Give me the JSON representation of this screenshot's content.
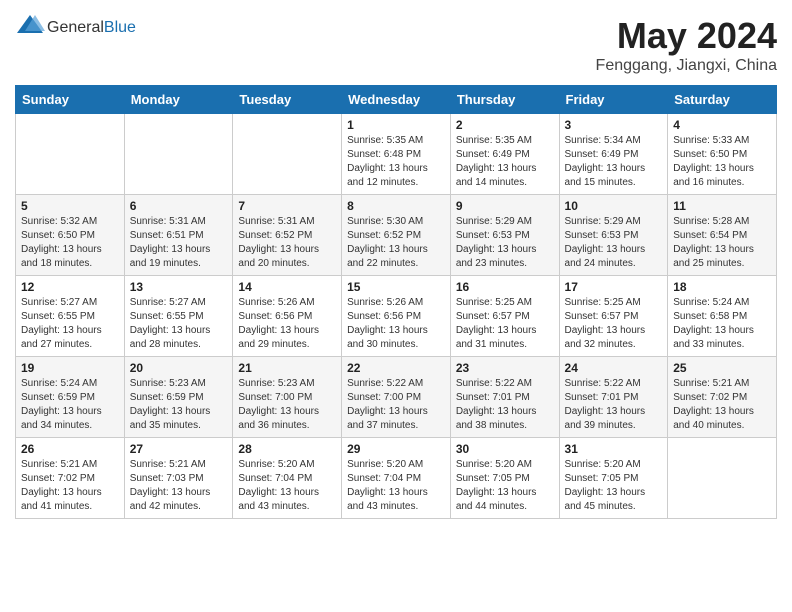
{
  "header": {
    "logo_general": "General",
    "logo_blue": "Blue",
    "title": "May 2024",
    "location": "Fenggang, Jiangxi, China"
  },
  "weekdays": [
    "Sunday",
    "Monday",
    "Tuesday",
    "Wednesday",
    "Thursday",
    "Friday",
    "Saturday"
  ],
  "weeks": [
    [
      {
        "day": "",
        "info": ""
      },
      {
        "day": "",
        "info": ""
      },
      {
        "day": "",
        "info": ""
      },
      {
        "day": "1",
        "info": "Sunrise: 5:35 AM\nSunset: 6:48 PM\nDaylight: 13 hours\nand 12 minutes."
      },
      {
        "day": "2",
        "info": "Sunrise: 5:35 AM\nSunset: 6:49 PM\nDaylight: 13 hours\nand 14 minutes."
      },
      {
        "day": "3",
        "info": "Sunrise: 5:34 AM\nSunset: 6:49 PM\nDaylight: 13 hours\nand 15 minutes."
      },
      {
        "day": "4",
        "info": "Sunrise: 5:33 AM\nSunset: 6:50 PM\nDaylight: 13 hours\nand 16 minutes."
      }
    ],
    [
      {
        "day": "5",
        "info": "Sunrise: 5:32 AM\nSunset: 6:50 PM\nDaylight: 13 hours\nand 18 minutes."
      },
      {
        "day": "6",
        "info": "Sunrise: 5:31 AM\nSunset: 6:51 PM\nDaylight: 13 hours\nand 19 minutes."
      },
      {
        "day": "7",
        "info": "Sunrise: 5:31 AM\nSunset: 6:52 PM\nDaylight: 13 hours\nand 20 minutes."
      },
      {
        "day": "8",
        "info": "Sunrise: 5:30 AM\nSunset: 6:52 PM\nDaylight: 13 hours\nand 22 minutes."
      },
      {
        "day": "9",
        "info": "Sunrise: 5:29 AM\nSunset: 6:53 PM\nDaylight: 13 hours\nand 23 minutes."
      },
      {
        "day": "10",
        "info": "Sunrise: 5:29 AM\nSunset: 6:53 PM\nDaylight: 13 hours\nand 24 minutes."
      },
      {
        "day": "11",
        "info": "Sunrise: 5:28 AM\nSunset: 6:54 PM\nDaylight: 13 hours\nand 25 minutes."
      }
    ],
    [
      {
        "day": "12",
        "info": "Sunrise: 5:27 AM\nSunset: 6:55 PM\nDaylight: 13 hours\nand 27 minutes."
      },
      {
        "day": "13",
        "info": "Sunrise: 5:27 AM\nSunset: 6:55 PM\nDaylight: 13 hours\nand 28 minutes."
      },
      {
        "day": "14",
        "info": "Sunrise: 5:26 AM\nSunset: 6:56 PM\nDaylight: 13 hours\nand 29 minutes."
      },
      {
        "day": "15",
        "info": "Sunrise: 5:26 AM\nSunset: 6:56 PM\nDaylight: 13 hours\nand 30 minutes."
      },
      {
        "day": "16",
        "info": "Sunrise: 5:25 AM\nSunset: 6:57 PM\nDaylight: 13 hours\nand 31 minutes."
      },
      {
        "day": "17",
        "info": "Sunrise: 5:25 AM\nSunset: 6:57 PM\nDaylight: 13 hours\nand 32 minutes."
      },
      {
        "day": "18",
        "info": "Sunrise: 5:24 AM\nSunset: 6:58 PM\nDaylight: 13 hours\nand 33 minutes."
      }
    ],
    [
      {
        "day": "19",
        "info": "Sunrise: 5:24 AM\nSunset: 6:59 PM\nDaylight: 13 hours\nand 34 minutes."
      },
      {
        "day": "20",
        "info": "Sunrise: 5:23 AM\nSunset: 6:59 PM\nDaylight: 13 hours\nand 35 minutes."
      },
      {
        "day": "21",
        "info": "Sunrise: 5:23 AM\nSunset: 7:00 PM\nDaylight: 13 hours\nand 36 minutes."
      },
      {
        "day": "22",
        "info": "Sunrise: 5:22 AM\nSunset: 7:00 PM\nDaylight: 13 hours\nand 37 minutes."
      },
      {
        "day": "23",
        "info": "Sunrise: 5:22 AM\nSunset: 7:01 PM\nDaylight: 13 hours\nand 38 minutes."
      },
      {
        "day": "24",
        "info": "Sunrise: 5:22 AM\nSunset: 7:01 PM\nDaylight: 13 hours\nand 39 minutes."
      },
      {
        "day": "25",
        "info": "Sunrise: 5:21 AM\nSunset: 7:02 PM\nDaylight: 13 hours\nand 40 minutes."
      }
    ],
    [
      {
        "day": "26",
        "info": "Sunrise: 5:21 AM\nSunset: 7:02 PM\nDaylight: 13 hours\nand 41 minutes."
      },
      {
        "day": "27",
        "info": "Sunrise: 5:21 AM\nSunset: 7:03 PM\nDaylight: 13 hours\nand 42 minutes."
      },
      {
        "day": "28",
        "info": "Sunrise: 5:20 AM\nSunset: 7:04 PM\nDaylight: 13 hours\nand 43 minutes."
      },
      {
        "day": "29",
        "info": "Sunrise: 5:20 AM\nSunset: 7:04 PM\nDaylight: 13 hours\nand 43 minutes."
      },
      {
        "day": "30",
        "info": "Sunrise: 5:20 AM\nSunset: 7:05 PM\nDaylight: 13 hours\nand 44 minutes."
      },
      {
        "day": "31",
        "info": "Sunrise: 5:20 AM\nSunset: 7:05 PM\nDaylight: 13 hours\nand 45 minutes."
      },
      {
        "day": "",
        "info": ""
      }
    ]
  ]
}
